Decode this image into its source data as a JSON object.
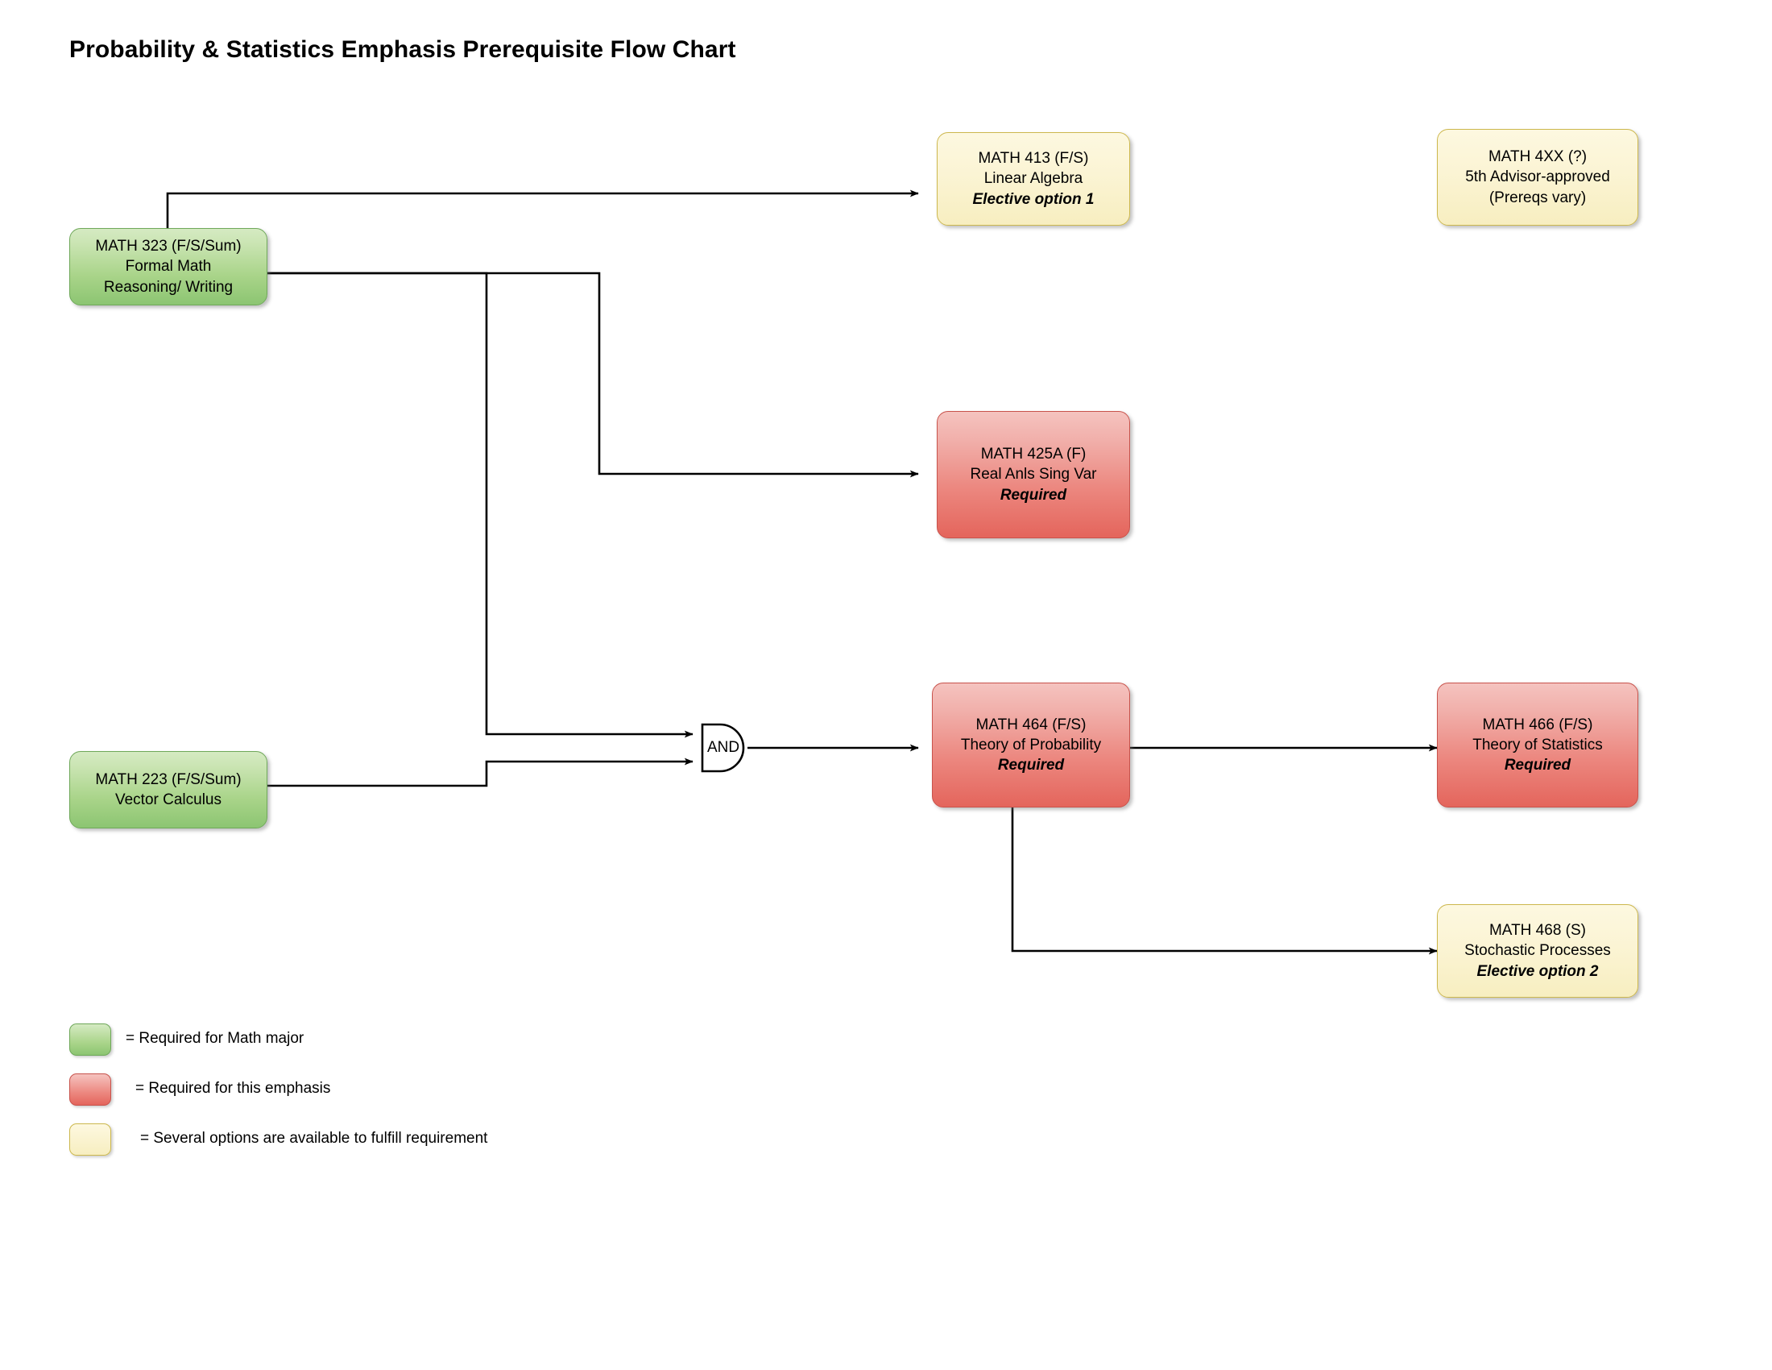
{
  "page": {
    "title": "Probability & Statistics Emphasis Prerequisite Flow Chart"
  },
  "colors": {
    "required_major": "#8cc572",
    "required_emphasis": "#e4655c",
    "several_options": "#f7eec0",
    "connector": "#000000",
    "text": "#000000"
  },
  "nodes": [
    {
      "id": "math-323",
      "category": "green",
      "lines": [
        "MATH 323 (F/S/Sum)",
        "Formal Math",
        "Reasoning/ Writing"
      ],
      "emphasis_line": null
    },
    {
      "id": "math-223",
      "category": "green",
      "lines": [
        "MATH 223 (F/S/Sum)",
        "Vector Calculus"
      ],
      "emphasis_line": null
    },
    {
      "id": "math-413",
      "category": "cream",
      "lines": [
        "MATH 413 (F/S)",
        "Linear Algebra",
        "Elective option 1"
      ],
      "emphasis_line": "Elective option 1"
    },
    {
      "id": "math-4xx",
      "category": "cream",
      "lines": [
        "MATH 4XX (?)",
        "5th Advisor-approved",
        "(Prereqs vary)"
      ],
      "emphasis_line": null
    },
    {
      "id": "math-425a",
      "category": "red",
      "lines": [
        "MATH 425A (F)",
        "Real Anls Sing Var",
        "Required"
      ],
      "emphasis_line": "Required"
    },
    {
      "id": "math-464",
      "category": "red",
      "lines": [
        "MATH 464 (F/S)",
        "Theory of Probability",
        "Required"
      ],
      "emphasis_line": "Required"
    },
    {
      "id": "math-466",
      "category": "red",
      "lines": [
        "MATH 466 (F/S)",
        "Theory of Statistics",
        "Required"
      ],
      "emphasis_line": "Required"
    },
    {
      "id": "math-468",
      "category": "cream",
      "lines": [
        "MATH 468 (S)",
        "Stochastic Processes",
        "Elective option 2"
      ],
      "emphasis_line": "Elective option 2"
    }
  ],
  "gate": {
    "label": "AND",
    "type": "and-gate"
  },
  "edges": [
    {
      "from": "math-323",
      "to": "math-413"
    },
    {
      "from": "math-323",
      "to": "math-425a"
    },
    {
      "from": "math-323",
      "to": "and-gate"
    },
    {
      "from": "math-223",
      "to": "and-gate"
    },
    {
      "from": "and-gate",
      "to": "math-464"
    },
    {
      "from": "math-464",
      "to": "math-466"
    },
    {
      "from": "math-464",
      "to": "math-468"
    }
  ],
  "legend": [
    {
      "swatch": "green",
      "label": "= Required for Math major"
    },
    {
      "swatch": "red",
      "label": "= Required for this emphasis"
    },
    {
      "swatch": "cream",
      "label": "= Several options are available to fulfill requirement"
    }
  ]
}
